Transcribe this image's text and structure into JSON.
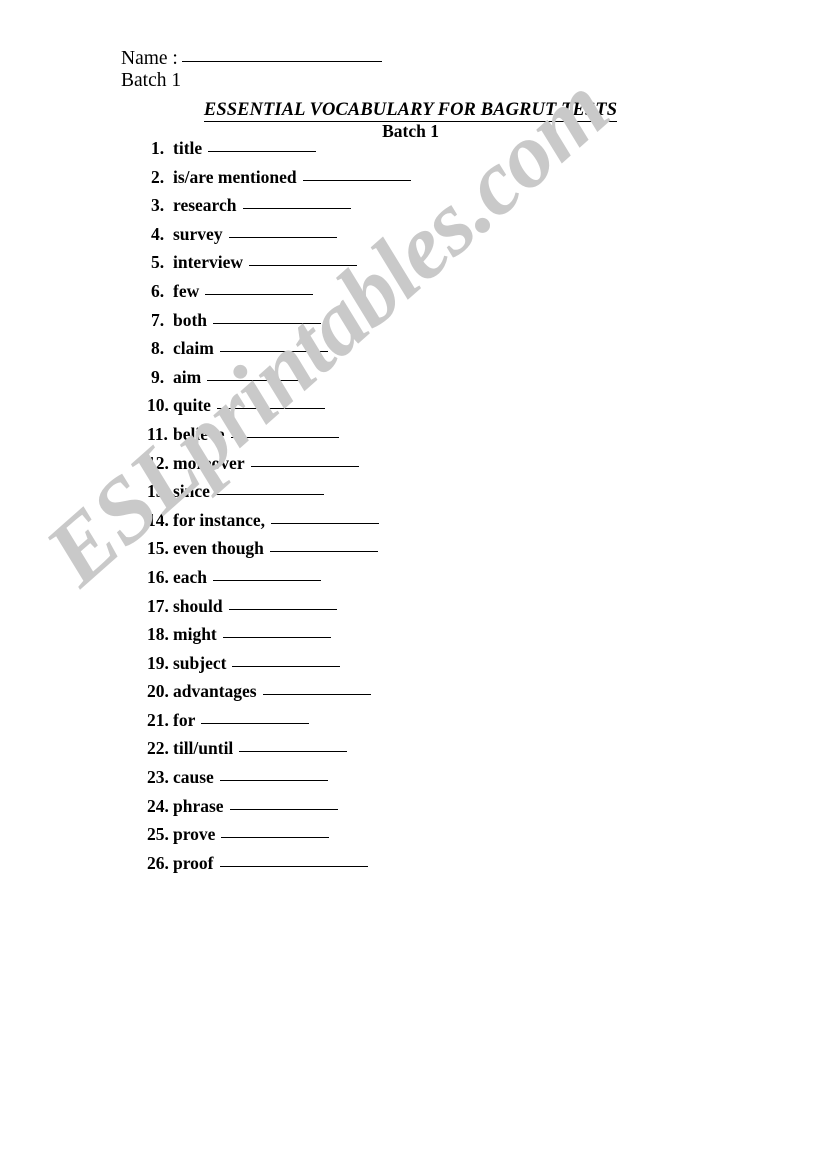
{
  "header": {
    "name_label": "Name :",
    "name_value": "",
    "batch_label": "Batch 1"
  },
  "title": {
    "main": "ESSENTIAL VOCABULARY FOR BAGRUT TESTS",
    "subtitle": "Batch 1"
  },
  "watermark": {
    "text": "ESLprintables.com",
    "color": "#c9c9c9"
  },
  "items": [
    {
      "num": "1.",
      "term": "title",
      "blank_width": 108
    },
    {
      "num": "2.",
      "term": "is/are mentioned",
      "blank_width": 108
    },
    {
      "num": "3.",
      "term": "research",
      "blank_width": 108
    },
    {
      "num": "4.",
      "term": "survey",
      "blank_width": 108
    },
    {
      "num": "5.",
      "term": "interview",
      "blank_width": 108
    },
    {
      "num": "6.",
      "term": "few",
      "blank_width": 108
    },
    {
      "num": "7.",
      "term": "both",
      "blank_width": 108
    },
    {
      "num": "8.",
      "term": "claim",
      "blank_width": 108
    },
    {
      "num": "9.",
      "term": "aim",
      "blank_width": 108
    },
    {
      "num": "10.",
      "term": "quite",
      "blank_width": 108
    },
    {
      "num": "11.",
      "term": "believe",
      "blank_width": 108
    },
    {
      "num": "12.",
      "term": "moreover",
      "blank_width": 108
    },
    {
      "num": "13.",
      "term": "since",
      "blank_width": 108
    },
    {
      "num": "14.",
      "term": "for instance,",
      "blank_width": 108
    },
    {
      "num": "15.",
      "term": "even though",
      "blank_width": 108
    },
    {
      "num": "16.",
      "term": "each",
      "blank_width": 108
    },
    {
      "num": "17.",
      "term": "should",
      "blank_width": 108
    },
    {
      "num": "18.",
      "term": "might",
      "blank_width": 108
    },
    {
      "num": "19.",
      "term": "subject",
      "blank_width": 108
    },
    {
      "num": "20.",
      "term": "advantages",
      "blank_width": 108
    },
    {
      "num": "21.",
      "term": "for",
      "blank_width": 108
    },
    {
      "num": "22.",
      "term": "till/until",
      "blank_width": 108
    },
    {
      "num": "23.",
      "term": "cause",
      "blank_width": 108
    },
    {
      "num": "24.",
      "term": "phrase",
      "blank_width": 108
    },
    {
      "num": "25.",
      "term": "prove",
      "blank_width": 108
    },
    {
      "num": "26.",
      "term": "proof",
      "blank_width": 148
    }
  ]
}
